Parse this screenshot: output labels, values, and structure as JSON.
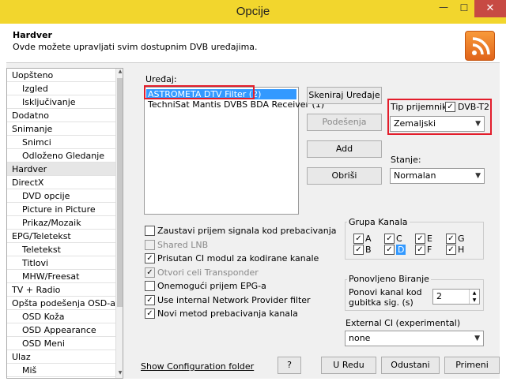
{
  "window": {
    "title": "Opcije",
    "minimize": "—",
    "maximize": "☐",
    "close": "✕"
  },
  "header": {
    "title": "Hardver",
    "description": "Ovde možete upravljati svim dostupnim DVB uređajima."
  },
  "tree": [
    {
      "label": "Uopšteno",
      "child": false
    },
    {
      "label": "Izgled",
      "child": true
    },
    {
      "label": "Isključivanje",
      "child": true
    },
    {
      "label": "Dodatno",
      "child": false
    },
    {
      "label": "Snimanje",
      "child": false
    },
    {
      "label": "Snimci",
      "child": true
    },
    {
      "label": "Odloženo Gledanje",
      "child": true
    },
    {
      "label": "Hardver",
      "child": false,
      "selected": true
    },
    {
      "label": "DirectX",
      "child": false
    },
    {
      "label": "DVD opcije",
      "child": true
    },
    {
      "label": "Picture in Picture",
      "child": true
    },
    {
      "label": "Prikaz/Mozaik",
      "child": true
    },
    {
      "label": "EPG/Teletekst",
      "child": false
    },
    {
      "label": "Teletekst",
      "child": true
    },
    {
      "label": "Titlovi",
      "child": true
    },
    {
      "label": "MHW/Freesat",
      "child": true
    },
    {
      "label": "TV + Radio",
      "child": false
    },
    {
      "label": "Opšta podešenja OSD-a",
      "child": false
    },
    {
      "label": "OSD Koža",
      "child": true
    },
    {
      "label": "OSD Appearance",
      "child": true
    },
    {
      "label": "OSD Meni",
      "child": true
    },
    {
      "label": "Ulaz",
      "child": false
    },
    {
      "label": "Miš",
      "child": true
    }
  ],
  "devices": {
    "label": "Uređaj:",
    "items": [
      "ASTROMETA DTV Filter (2)",
      "TechniSat Mantis DVBS BDA Receiver (1)"
    ]
  },
  "buttons": {
    "scan": "Skeniraj Uređaje",
    "settings": "Podešenja",
    "add": "Add",
    "remove": "Obriši",
    "help": "?",
    "ok": "U Redu",
    "cancel": "Odustani",
    "apply": "Primeni"
  },
  "receiver": {
    "label": "Tip prijemnika:",
    "dvbt2_label": "DVB-T2",
    "dvbt2_checked": true,
    "type_value": "Zemaljski"
  },
  "state": {
    "label": "Stanje:",
    "value": "Normalan"
  },
  "options": [
    {
      "label": "Zaustavi prijem signala kod prebacivanja",
      "checked": false,
      "disabled": false
    },
    {
      "label": "Shared LNB",
      "checked": false,
      "disabled": true
    },
    {
      "label": "Prisutan CI modul za kodirane kanale",
      "checked": true,
      "disabled": false
    },
    {
      "label": "Otvori celi Transponder",
      "checked": true,
      "disabled": true
    },
    {
      "label": "Onemogući prijem EPG-a",
      "checked": false,
      "disabled": false
    },
    {
      "label": "Use internal Network Provider filter",
      "checked": true,
      "disabled": false
    },
    {
      "label": "Novi metod prebacivanja kanala",
      "checked": true,
      "disabled": false
    }
  ],
  "channel_group": {
    "title": "Grupa Kanala",
    "items": [
      {
        "label": "A",
        "checked": true
      },
      {
        "label": "C",
        "checked": true
      },
      {
        "label": "E",
        "checked": true
      },
      {
        "label": "G",
        "checked": true
      },
      {
        "label": "B",
        "checked": true
      },
      {
        "label": "D",
        "checked": true,
        "highlight": true
      },
      {
        "label": "F",
        "checked": true
      },
      {
        "label": "H",
        "checked": true
      }
    ]
  },
  "redial": {
    "title": "Ponovljeno Biranje",
    "label_line1": "Ponovi kanal kod",
    "label_line2": "gubitka sig. (s)",
    "value": "2"
  },
  "external_ci": {
    "label": "External CI (experimental)",
    "value": "none"
  },
  "footer": {
    "config_link": "Show Configuration folder"
  }
}
